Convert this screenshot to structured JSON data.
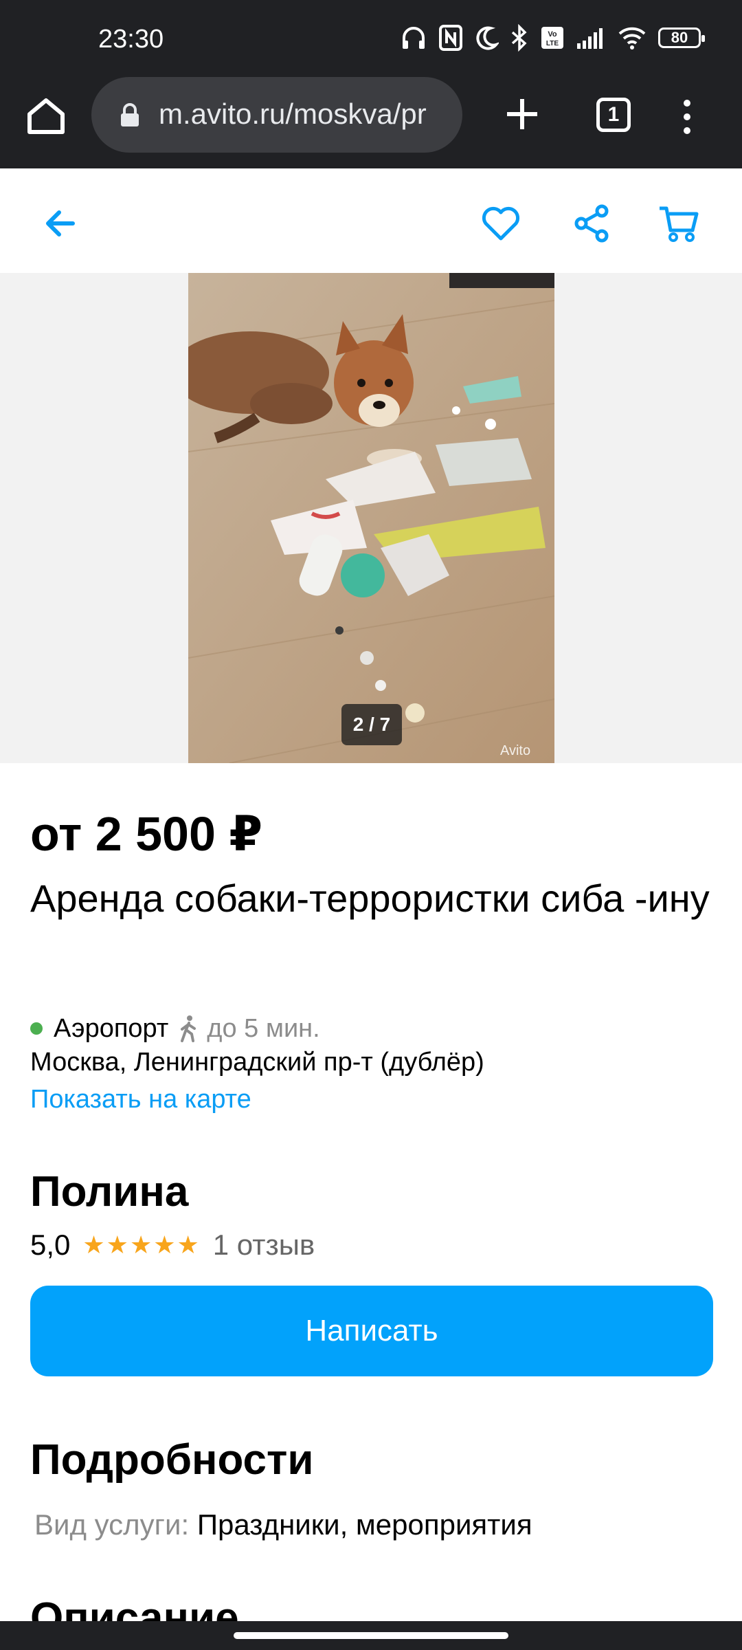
{
  "status_bar": {
    "time": "23:30",
    "battery": "80",
    "icons": [
      "headphones-icon",
      "nfc-icon",
      "moon-icon",
      "bluetooth-icon",
      "volte-icon",
      "signal-icon",
      "wifi-icon",
      "battery-icon"
    ]
  },
  "browser": {
    "url": "m.avito.ru/moskva/pr",
    "tab_count": "1"
  },
  "header": {
    "icons": [
      "back-arrow-icon",
      "heart-icon",
      "share-icon",
      "cart-icon"
    ],
    "accent_color": "#0a9df5"
  },
  "gallery": {
    "counter": "2 / 7",
    "watermark": "Avito"
  },
  "listing": {
    "price": "от 2 500 ₽",
    "title": "Аренда собаки-террористки сиба -ину",
    "metro_station": "Аэропорт",
    "walk_time": "до 5 мин.",
    "address": "Москва, Ленинградский пр-т (дублёр)",
    "map_link": "Показать на карте"
  },
  "seller": {
    "name": "Полина",
    "rating": "5,0",
    "stars": "★★★★★",
    "reviews": "1 отзыв",
    "write_button": "Написать",
    "button_color": "#02a2fb"
  },
  "details": {
    "heading": "Подробности",
    "service_label": "Вид услуги:",
    "service_value": "Праздники, мероприятия"
  },
  "description": {
    "heading": "Описание"
  }
}
